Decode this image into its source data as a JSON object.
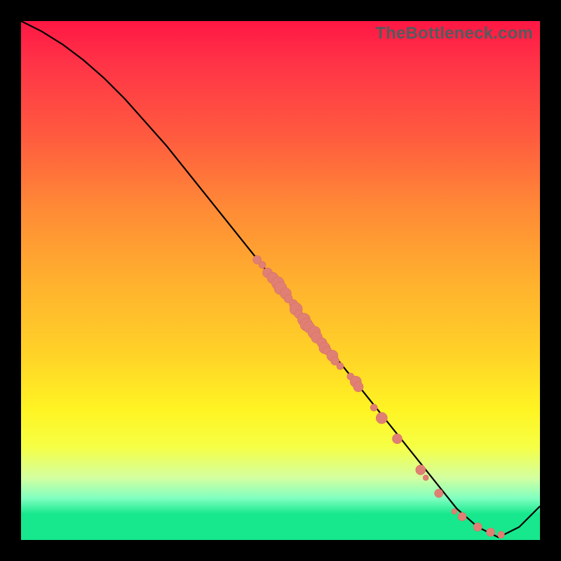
{
  "watermark": "TheBottleneck.com",
  "colors": {
    "background": "#000000",
    "line": "#000000",
    "marker_fill": "#e08074",
    "marker_stroke": "#d86e62"
  },
  "chart_data": {
    "type": "line",
    "title": "",
    "xlabel": "",
    "ylabel": "",
    "xlim": [
      0,
      100
    ],
    "ylim": [
      0,
      100
    ],
    "grid": false,
    "legend": false,
    "series": [
      {
        "name": "curve",
        "x": [
          0,
          4,
          8,
          12,
          16,
          20,
          24,
          28,
          32,
          36,
          40,
          44,
          48,
          52,
          56,
          60,
          64,
          68,
          72,
          76,
          80,
          84,
          88,
          92,
          96,
          100
        ],
        "y": [
          100,
          98,
          95.5,
          92.5,
          89,
          85,
          80.5,
          76,
          71,
          66,
          61,
          56,
          51,
          46,
          41,
          36,
          31,
          26,
          21,
          16,
          11,
          6,
          2.5,
          0.5,
          2.5,
          6.5
        ]
      }
    ],
    "markers": [
      {
        "x": 45.5,
        "y": 54.0,
        "r": 6
      },
      {
        "x": 46.5,
        "y": 53.0,
        "r": 5
      },
      {
        "x": 47.5,
        "y": 51.5,
        "r": 7
      },
      {
        "x": 48.5,
        "y": 50.5,
        "r": 8
      },
      {
        "x": 49.5,
        "y": 49.5,
        "r": 9
      },
      {
        "x": 50.0,
        "y": 48.5,
        "r": 9
      },
      {
        "x": 51.0,
        "y": 47.5,
        "r": 8
      },
      {
        "x": 51.5,
        "y": 46.5,
        "r": 6
      },
      {
        "x": 52.5,
        "y": 45.5,
        "r": 6
      },
      {
        "x": 53.0,
        "y": 44.5,
        "r": 9
      },
      {
        "x": 53.5,
        "y": 43.5,
        "r": 6
      },
      {
        "x": 54.5,
        "y": 42.5,
        "r": 9
      },
      {
        "x": 55.0,
        "y": 41.5,
        "r": 9
      },
      {
        "x": 55.5,
        "y": 41.0,
        "r": 8
      },
      {
        "x": 56.5,
        "y": 40.0,
        "r": 9
      },
      {
        "x": 57.0,
        "y": 39.0,
        "r": 8
      },
      {
        "x": 58.0,
        "y": 38.0,
        "r": 7
      },
      {
        "x": 58.5,
        "y": 37.0,
        "r": 8
      },
      {
        "x": 59.0,
        "y": 36.5,
        "r": 6
      },
      {
        "x": 60.0,
        "y": 35.5,
        "r": 8
      },
      {
        "x": 60.5,
        "y": 34.5,
        "r": 6
      },
      {
        "x": 61.5,
        "y": 33.5,
        "r": 5
      },
      {
        "x": 63.5,
        "y": 31.5,
        "r": 5
      },
      {
        "x": 64.5,
        "y": 30.5,
        "r": 8
      },
      {
        "x": 65.0,
        "y": 29.5,
        "r": 7
      },
      {
        "x": 68.0,
        "y": 25.5,
        "r": 5
      },
      {
        "x": 69.5,
        "y": 23.5,
        "r": 8
      },
      {
        "x": 72.5,
        "y": 19.5,
        "r": 7
      },
      {
        "x": 77.0,
        "y": 13.5,
        "r": 7
      },
      {
        "x": 78.0,
        "y": 12.0,
        "r": 4
      },
      {
        "x": 80.5,
        "y": 9.0,
        "r": 6
      },
      {
        "x": 83.5,
        "y": 5.5,
        "r": 4
      },
      {
        "x": 85.0,
        "y": 4.5,
        "r": 6
      },
      {
        "x": 88.0,
        "y": 2.5,
        "r": 6
      },
      {
        "x": 90.5,
        "y": 1.5,
        "r": 6
      },
      {
        "x": 92.5,
        "y": 1.0,
        "r": 5
      }
    ]
  }
}
